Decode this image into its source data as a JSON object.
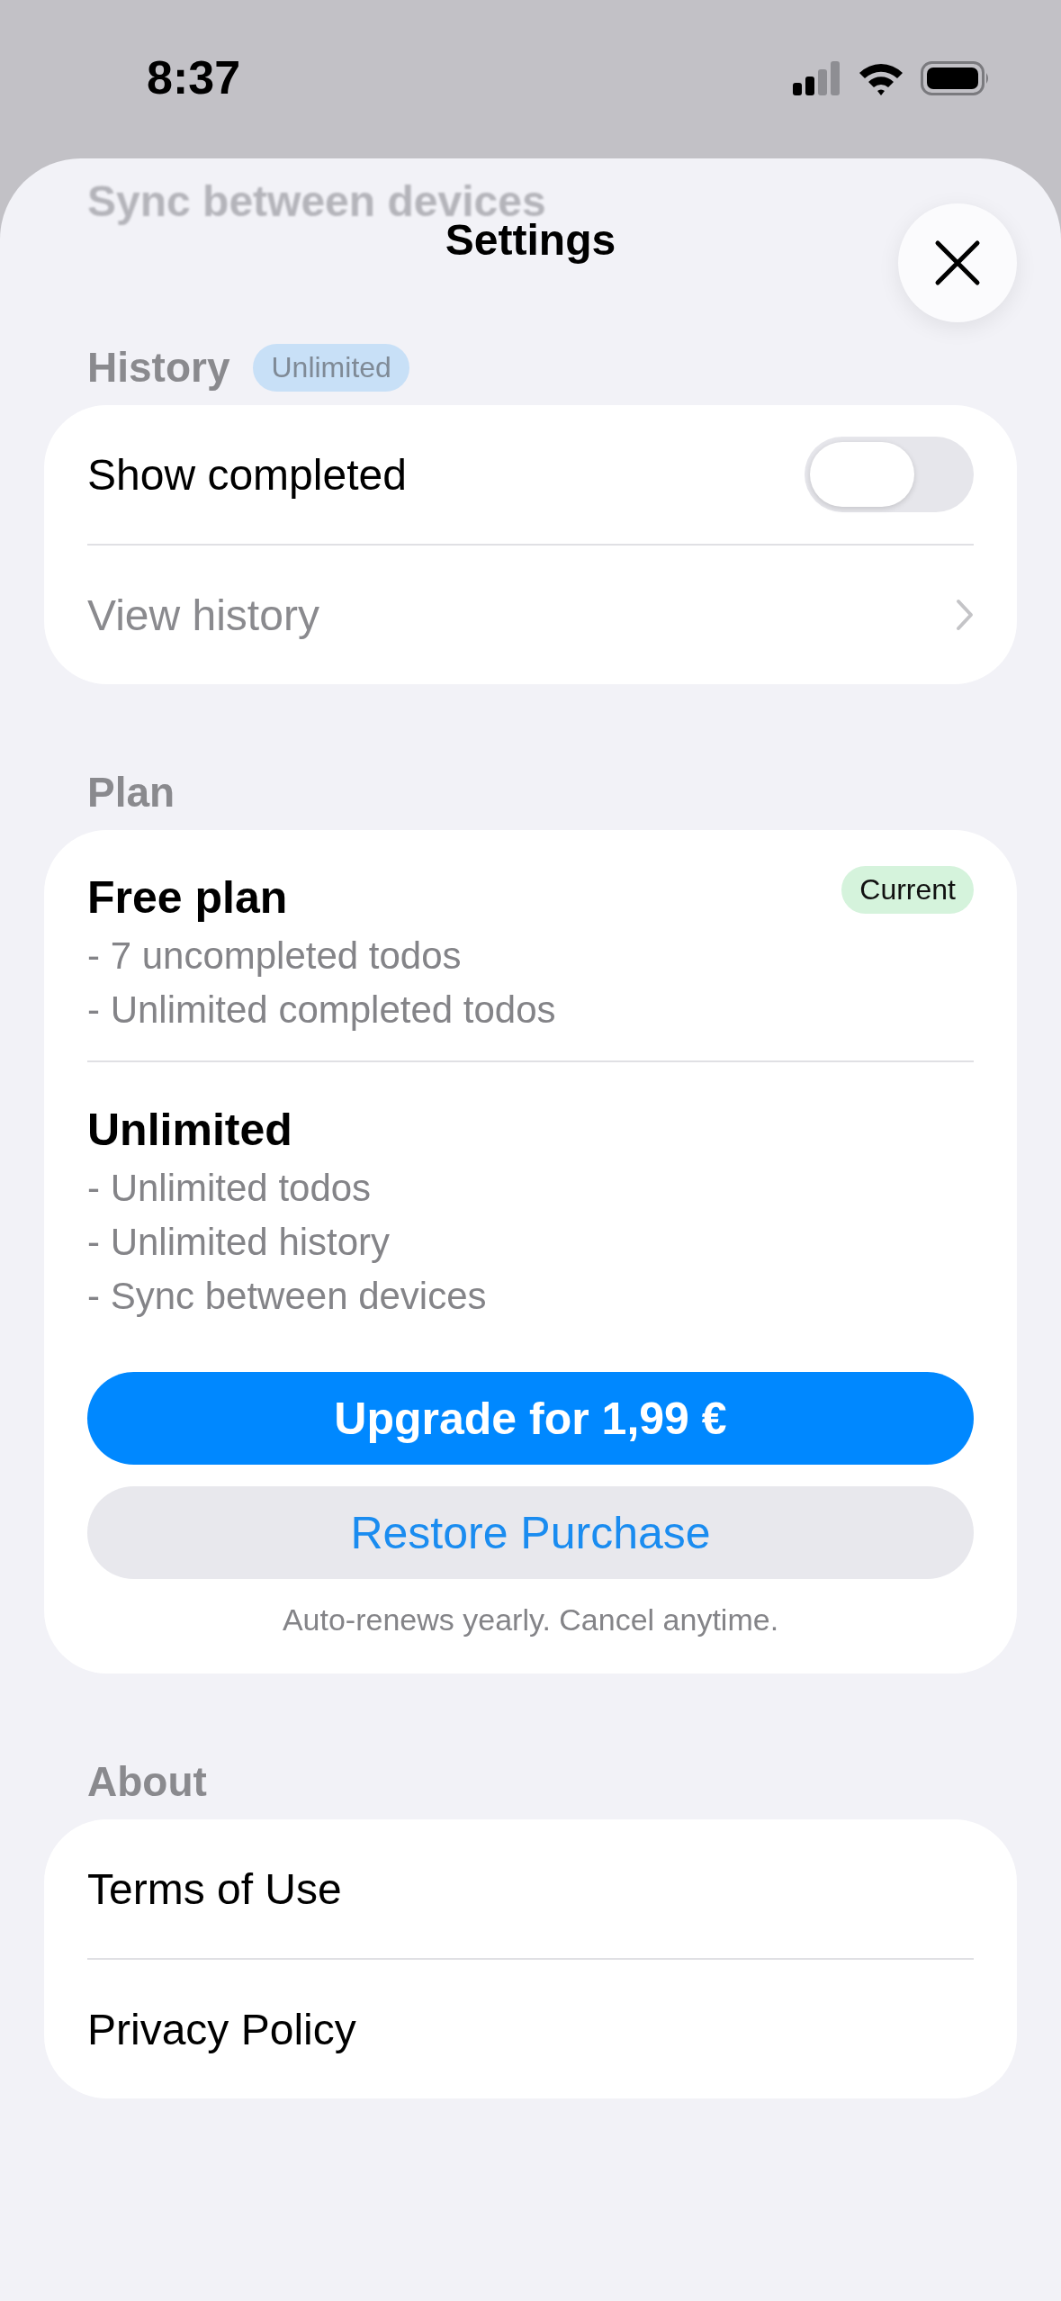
{
  "status_bar": {
    "time": "8:37"
  },
  "behind_header": {
    "label": "Sync between devices"
  },
  "header": {
    "title": "Settings"
  },
  "sections": [
    {
      "title": "History",
      "badge": "Unlimited",
      "kind": "rows",
      "rows": [
        {
          "label": "Show completed",
          "kind": "toggle",
          "on": false
        },
        {
          "label": "View history",
          "kind": "link",
          "disabled": true
        }
      ]
    },
    {
      "title": "Plan",
      "kind": "plans",
      "plans": [
        {
          "name": "Free plan",
          "badge": "Current",
          "features": [
            "- 7 uncompleted todos",
            "- Unlimited completed todos"
          ]
        },
        {
          "name": "Unlimited",
          "features": [
            "- Unlimited todos",
            "- Unlimited history",
            "- Sync between devices"
          ]
        }
      ],
      "buttons": [
        {
          "label": "Upgrade for 1,99 €",
          "kind": "primary"
        },
        {
          "label": "Restore Purchase",
          "kind": "secondary"
        }
      ],
      "note": "Auto-renews yearly. Cancel anytime."
    },
    {
      "title": "About",
      "kind": "rows",
      "rows": [
        {
          "label": "Terms of Use",
          "kind": "plain"
        },
        {
          "label": "Privacy Policy",
          "kind": "plain"
        }
      ]
    }
  ]
}
